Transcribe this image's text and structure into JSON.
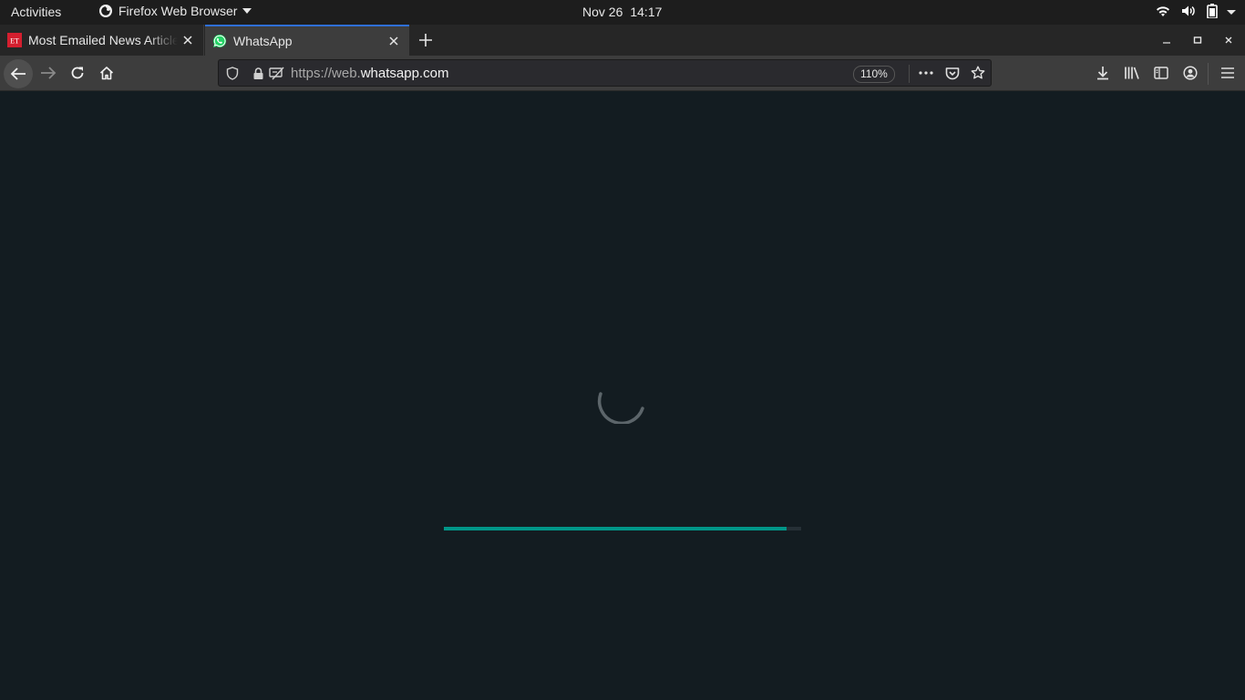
{
  "system_bar": {
    "activities": "Activities",
    "app_name": "Firefox Web Browser",
    "date": "Nov 26",
    "time": "14:17",
    "status_icons": [
      "wifi-icon",
      "volume-icon",
      "battery-icon",
      "chevron-down-icon"
    ]
  },
  "tabs": [
    {
      "title": "Most Emailed News Articles",
      "favicon": "ET",
      "favicon_color": "#d51f2f",
      "active": false
    },
    {
      "title": "WhatsApp",
      "favicon": "whatsapp-icon",
      "favicon_color": "#25d366",
      "active": true
    }
  ],
  "toolbar": {
    "url_prefix": "https://web.",
    "url_host": "whatsapp.com",
    "zoom": "110%"
  },
  "page": {
    "background": "#131c21",
    "accent": "#009688",
    "loading_progress": 0.96
  }
}
